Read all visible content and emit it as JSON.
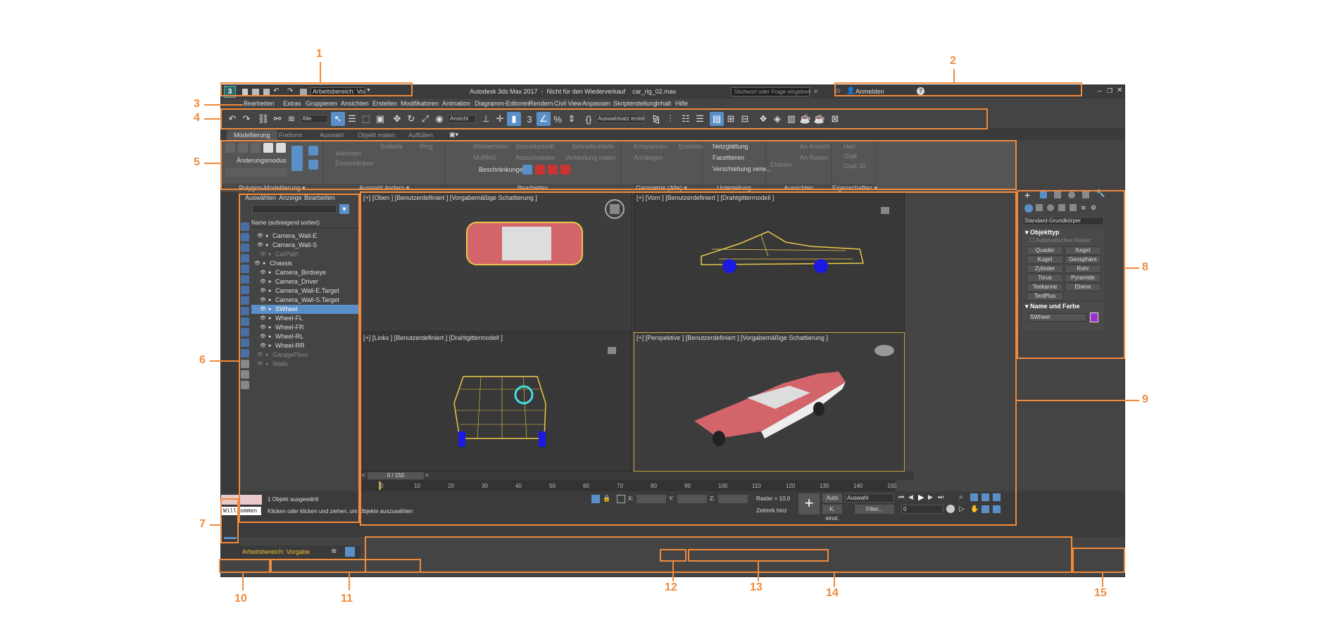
{
  "title": {
    "workspace_label": "Arbeitsbereich: Vorgz",
    "app_title": "Autodesk 3ds Max 2017  -  Nicht für den Wiederverkauf    car_rig_02.max",
    "search_placeholder": "Stichwort oder Frage eingeben",
    "signin": "Anmelden"
  },
  "menu": [
    "Bearbeiten",
    "Extras",
    "Gruppieren",
    "Ansichten",
    "Erstellen",
    "Modifikatoren",
    "Animation",
    "Diagramm-Editoren",
    "Rendern",
    "Civil View",
    "Anpassen",
    "Skripterstellung",
    "Inhalt",
    "Hilfe"
  ],
  "toolbar": {
    "filter": "Alle",
    "refcoord": "Ansicht",
    "selset": "Auswahlsatz erstelle"
  },
  "ribbon_tabs": [
    "Modellierung",
    "Freiform",
    "Auswahl",
    "Objekt malen",
    "Auffüllen"
  ],
  "ribbon": {
    "mode": "Änderungsmodus",
    "poly": "Polygon-Modellierung",
    "sel_change": "Auswahl ändern",
    "edit": "Bearbeiten",
    "geom": "Geometrie (Alle)",
    "subdiv": "Unterteilung",
    "align": "Ausrichten",
    "props": "Eigenschaften",
    "items": [
      "Wachsen",
      "Einschränken",
      "Schleife",
      "Ring",
      "Wiederholen",
      "NURMS",
      "Schnellschnitt",
      "Ausschneiden",
      "Schnellschleife",
      "Verbindung malen",
      "Beschränkungen:",
      "Entspannen",
      "Anhängen",
      "Erstellen",
      "Netzglättung",
      "Facettieren",
      "Verschiebung verw...",
      "Ebenen",
      "An Ansicht",
      "An Raster",
      "Hart",
      "Glatt",
      "Glatt 30"
    ]
  },
  "scene": {
    "menu": [
      "Auswählen",
      "Anzeige",
      "Bearbeiten"
    ],
    "header": "Name (aufsteigend sortiert)",
    "rows": [
      {
        "name": "Camera_Wall-E",
        "indent": 1
      },
      {
        "name": "Camera_Wall-S",
        "indent": 1
      },
      {
        "name": "CarPath",
        "indent": 2,
        "dim": true
      },
      {
        "name": "Chassis",
        "indent": 0
      },
      {
        "name": "Camera_Birdseye",
        "indent": 2
      },
      {
        "name": "Camera_Driver",
        "indent": 2
      },
      {
        "name": "Camera_Wall-E.Target",
        "indent": 2
      },
      {
        "name": "Camera_Wall-S.Target",
        "indent": 2
      },
      {
        "name": "SWheel",
        "indent": 2,
        "sel": true
      },
      {
        "name": "Wheel-FL",
        "indent": 2
      },
      {
        "name": "Wheel-FR",
        "indent": 2
      },
      {
        "name": "Wheel-RL",
        "indent": 2
      },
      {
        "name": "Wheel-RR",
        "indent": 2
      },
      {
        "name": "GarageFloor",
        "indent": 1,
        "dim": true
      },
      {
        "name": "Walls",
        "indent": 1,
        "dim": true
      }
    ],
    "workspace": "Arbeitsbereich: Vorgabe"
  },
  "viewports": [
    "[+] [Oben ] [Benutzerdefiniert ] [Vorgabemäßige Schattierung ]",
    "[+] [Vorn ] [Benutzerdefiniert ] [Drahtgittermodell ]",
    "[+] [Links ] [Benutzerdefiniert ] [Drahtgittermodell ]",
    "[+] [Perspektive ] [Benutzerdefiniert ] [Vorgabemäßige Schattierung ]"
  ],
  "command": {
    "dropdown": "Standard-Grundkörper",
    "rollout1": "Objekttyp",
    "autogrid": "Automatisches Raster",
    "buttons": [
      "Quader",
      "Kegel",
      "Kugel",
      "Geosphäre",
      "Zylinder",
      "Rohr",
      "Torus",
      "Pyramide",
      "Teekanne",
      "Ebene",
      "TextPlus"
    ],
    "rollout2": "Name und Farbe",
    "name": "SWheel"
  },
  "timeline": {
    "frame": "0 / 150",
    "ticks": [
      "0",
      "10",
      "20",
      "30",
      "40",
      "50",
      "60",
      "70",
      "80",
      "90",
      "100",
      "110",
      "120",
      "130",
      "140",
      "150"
    ]
  },
  "status": {
    "script": "Willkommen b",
    "selected": "1 Objekt ausgewählt",
    "prompt": "Klicken oder klicken und ziehen, um Objekte auszuwählen",
    "x": "X:",
    "y": "Y:",
    "z": "Z:",
    "grid": "Raster = 10,0",
    "timetag": "Zeitmrk hinz",
    "auto": "Auto",
    "keyset": "K. einst.",
    "sel": "Auswahl",
    "filter": "Filter...",
    "frame": "0"
  },
  "callouts": [
    "1",
    "2",
    "3",
    "4",
    "5",
    "6",
    "7",
    "8",
    "9",
    "10",
    "11",
    "12",
    "13",
    "14",
    "15"
  ],
  "colors": {
    "accent": "#f08a3c",
    "select": "#5b8fc7",
    "car_red": "#d2646a",
    "wire": "#e8c84a"
  }
}
